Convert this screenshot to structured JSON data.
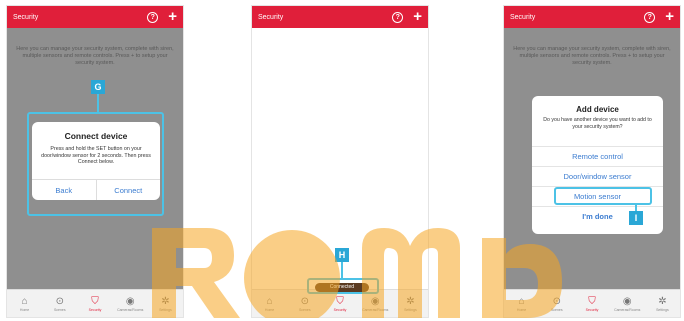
{
  "screens": [
    {
      "header": {
        "title": "Security",
        "help_icon": "?",
        "add_icon": "+"
      },
      "intro": "Here you can manage your security system, complete with siren, multiple sensors and remote controls. Press + to setup your security system.",
      "callout": "G",
      "dialog": {
        "title": "Connect device",
        "message": "Press and hold the SET button on your door/window sensor for 2 seconds. Then press Connect below.",
        "back": "Back",
        "connect": "Connect"
      }
    },
    {
      "header": {
        "title": "Security",
        "help_icon": "?",
        "add_icon": "+"
      },
      "callout": "H",
      "toast": "Connected"
    },
    {
      "header": {
        "title": "Security",
        "help_icon": "?",
        "add_icon": "+"
      },
      "intro": "Here you can manage your security system, complete with siren, multiple sensors and remote controls. Press + to setup your security system.",
      "callout": "I",
      "dialog": {
        "title": "Add device",
        "message": "Do you have another device you want to add to your security system?",
        "options": [
          "Remote control",
          "Door/window sensor",
          "Motion sensor",
          "I'm done"
        ]
      }
    }
  ],
  "tabs": [
    {
      "label": "Home",
      "icon": "home-icon"
    },
    {
      "label": "Scenes",
      "icon": "play-circle-icon"
    },
    {
      "label": "Security",
      "icon": "shield-icon",
      "active": true
    },
    {
      "label": "Cameras/Rooms",
      "icon": "camera-icon"
    },
    {
      "label": "Settings",
      "icon": "gear-icon"
    }
  ],
  "colors": {
    "brand": "#e01f3a",
    "link": "#3b7cd0",
    "highlight": "#4cc2e6",
    "watermark": "#f5a623"
  }
}
